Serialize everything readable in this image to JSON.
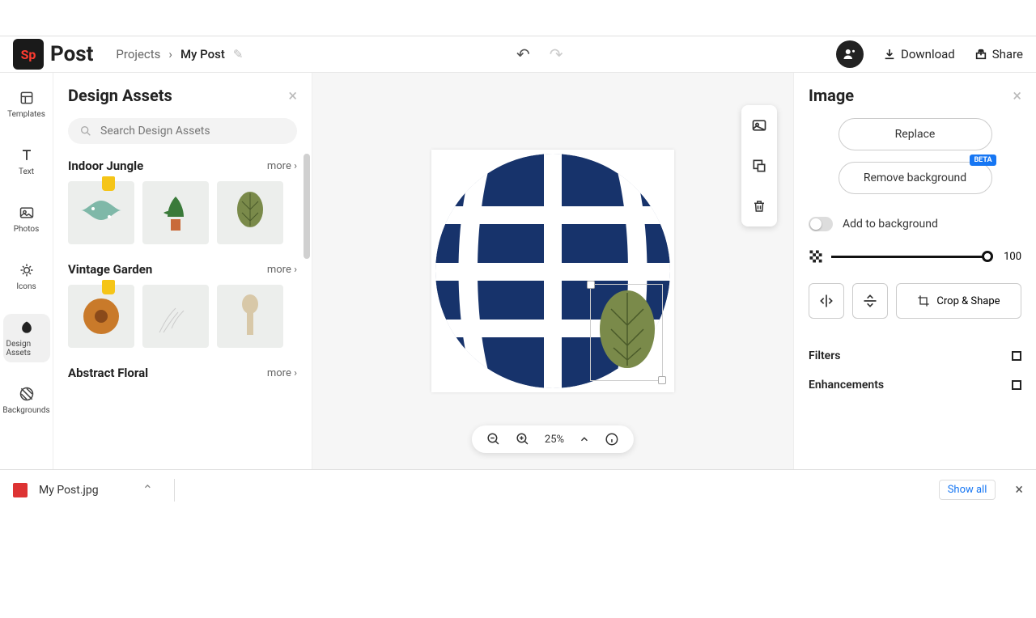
{
  "app": {
    "logo": "Sp",
    "name": "Post"
  },
  "breadcrumb": {
    "root": "Projects",
    "current": "My Post"
  },
  "topbar": {
    "download": "Download",
    "share": "Share"
  },
  "rail": {
    "items": [
      {
        "label": "Templates"
      },
      {
        "label": "Text"
      },
      {
        "label": "Photos"
      },
      {
        "label": "Icons"
      },
      {
        "label": "Design Assets"
      },
      {
        "label": "Backgrounds"
      }
    ]
  },
  "left_panel": {
    "title": "Design Assets",
    "search_placeholder": "Search Design Assets",
    "more": "more",
    "categories": [
      {
        "name": "Indoor Jungle"
      },
      {
        "name": "Vintage Garden"
      },
      {
        "name": "Abstract Floral"
      }
    ]
  },
  "zoom": {
    "level": "25%"
  },
  "right_panel": {
    "title": "Image",
    "replace": "Replace",
    "remove_bg": "Remove background",
    "beta": "BETA",
    "add_bg": "Add to background",
    "opacity": "100",
    "crop": "Crop & Shape",
    "filters": "Filters",
    "enhancements": "Enhancements"
  },
  "download_bar": {
    "filename": "My Post.jpg",
    "show_all": "Show all"
  },
  "colors": {
    "globe": "#17336b",
    "leaf": "#7a8a4a"
  }
}
